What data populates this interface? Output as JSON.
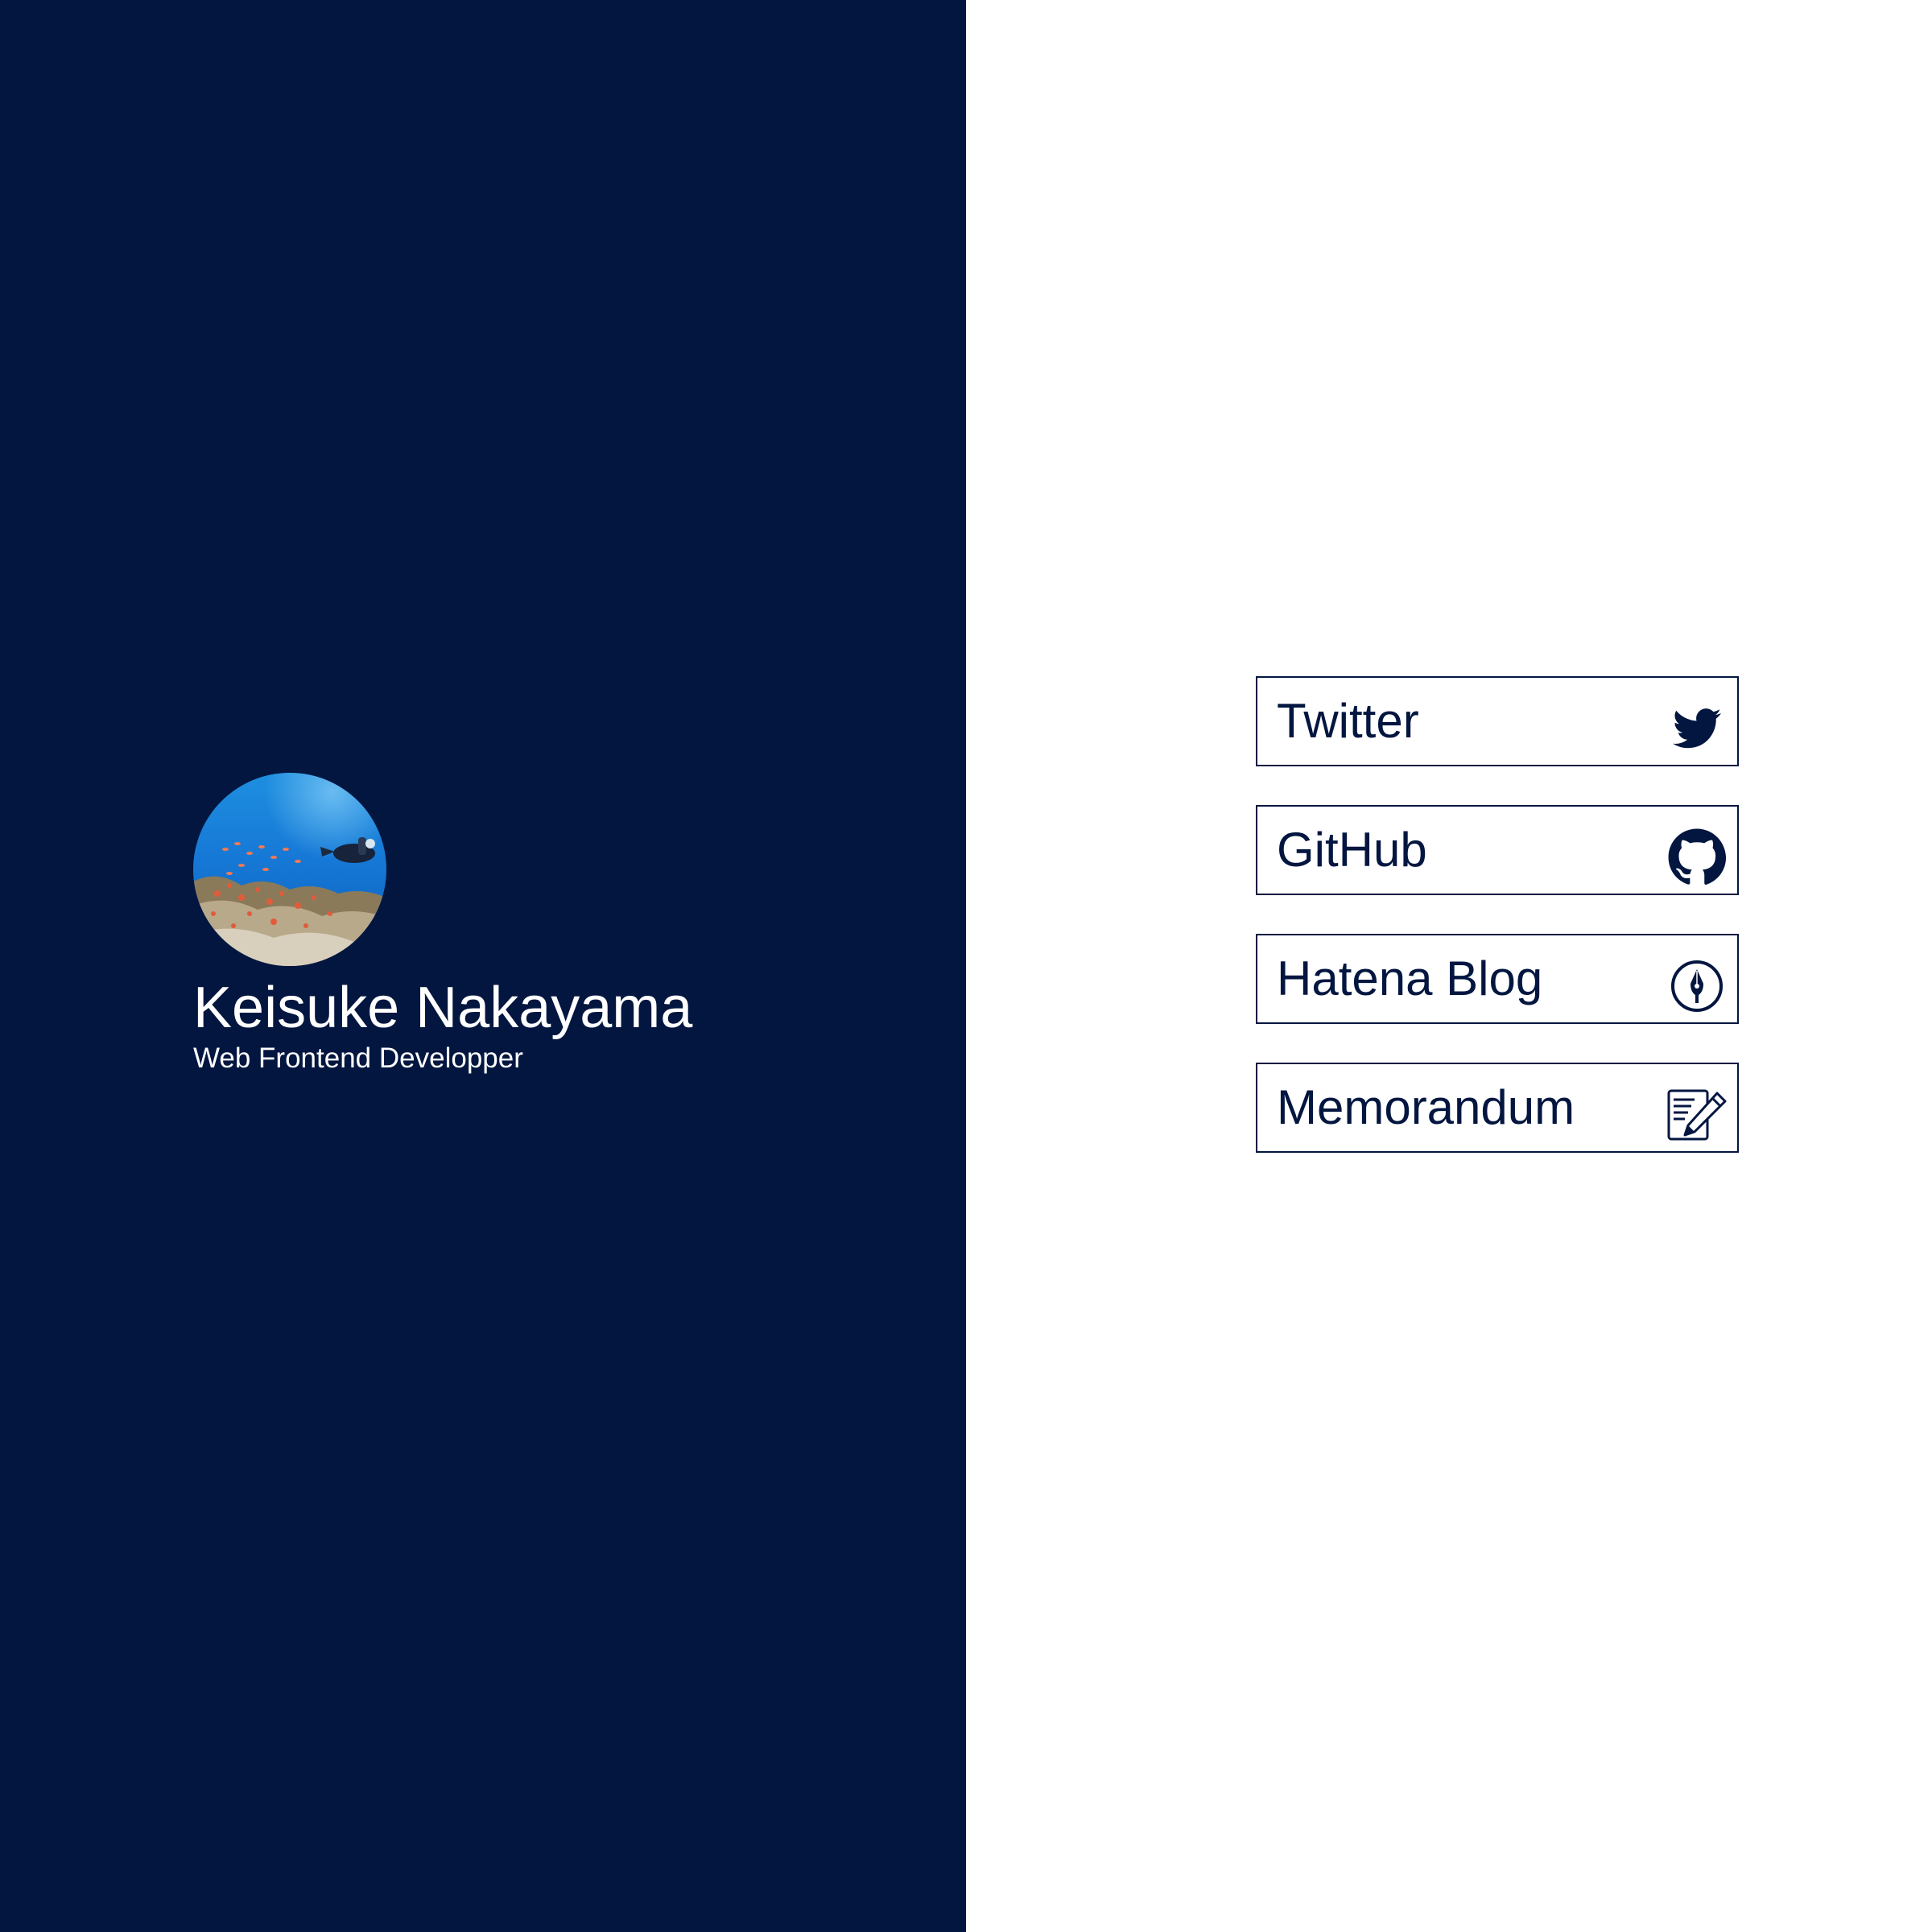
{
  "profile": {
    "name": "Keisuke Nakayama",
    "role": "Web Frontend Developper",
    "avatar_icon": "diver-reef-photo"
  },
  "links": [
    {
      "label": "Twitter",
      "icon": "twitter-bird-icon"
    },
    {
      "label": "GitHub",
      "icon": "github-octocat-icon"
    },
    {
      "label": "Hatena Blog",
      "icon": "pen-nib-circle-icon"
    },
    {
      "label": "Memorandum",
      "icon": "memo-pencil-icon"
    }
  ],
  "colors": {
    "navy": "#031640",
    "white": "#ffffff"
  }
}
